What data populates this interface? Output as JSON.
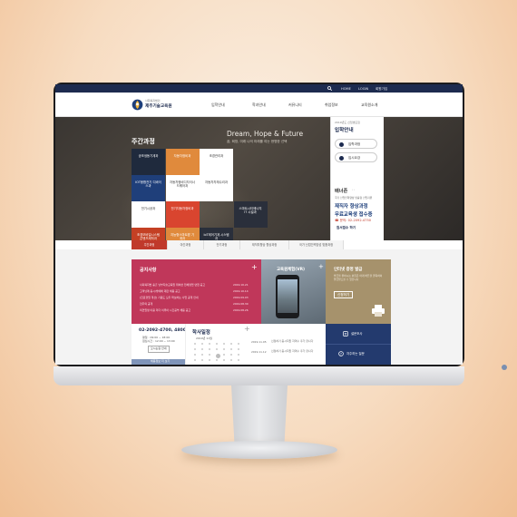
{
  "topbar": {
    "home": "HOME",
    "login": "LOGIN",
    "join": "회원가입"
  },
  "logo": {
    "sub": "사회복지법인",
    "name": "제주기술교육원"
  },
  "nav": [
    "입학안내",
    "학과안내",
    "커뮤니티",
    "취업정보",
    "교육원소개"
  ],
  "hero": {
    "title": "주간과정",
    "tag_en": "Dream, Hope & Future",
    "tag_ko": "꿈, 희망, 미래 나의 미래를 여는 현명한 선택"
  },
  "tiles": [
    {
      "label": "공조냉동기계과",
      "color": "#1f2a3d",
      "text": "#ffffff"
    },
    {
      "label": "자동차정비과",
      "color": "#e08a3c",
      "text": "#ffffff"
    },
    {
      "label": "조경관리과",
      "color": "#ffffff",
      "text": "#333333"
    },
    {
      "label": "",
      "color": "",
      "text": ""
    },
    {
      "label": "IOT융합전기 디바이스과",
      "color": "#1f3f7a",
      "text": "#ffffff"
    },
    {
      "label": "자동차정비디자이너 드웨어과",
      "color": "#ffffff",
      "text": "#333333"
    },
    {
      "label": "자동차차체수리과",
      "color": "#ffffff",
      "text": "#333333"
    },
    {
      "label": "",
      "color": "",
      "text": ""
    },
    {
      "label": "전기시공과",
      "color": "#ffffff",
      "text": "#333333"
    },
    {
      "label": "전기자동차정비과",
      "color": "#d9452f",
      "text": "#ffffff"
    },
    {
      "label": "",
      "color": "",
      "text": ""
    },
    {
      "label": "스마트시티에너지 IT 시설과",
      "color": "#2a2f3b",
      "text": "#ffffff"
    },
    {
      "label": "조경모바일시스템 콘텐츠제작과",
      "color": "#c44024",
      "text": "#ffffff"
    },
    {
      "label": "지능형스마트팜 기계과",
      "color": "#e08a3c",
      "text": "#ffffff"
    },
    {
      "label": "IoT제어기계 시스템과",
      "color": "#2a2f3b",
      "text": "#ffffff"
    }
  ],
  "side": {
    "small": "2019년도 신입생모집",
    "title": "입학안내",
    "btn1": "입학과정",
    "btn2": "입시요강",
    "banner_head": "배너존",
    "banner_sub": "국가 신업인력양성 맞춤형 신업지원",
    "banner_main": "재직자 향상과정",
    "banner_main2": "무료교육생 접수중",
    "banner_tel": "☎ 문의: 02-2092-4750",
    "banner_btn": "원서접수 하기"
  },
  "tabs": [
    "주간과정",
    "야간과정",
    "단기과정",
    "재직자향상 향상과정",
    "국가 신업인력양성 맞춤과정"
  ],
  "notice": {
    "title": "공지사항",
    "plus": "+",
    "items": [
      {
        "text": "사회복지법 충혼 남부지술교육원 위하면 전체영업 면접 공고",
        "date": "2019.10.21"
      },
      {
        "text": "고객님께 응시/밖에에 대한 채용 공고",
        "date": "2019.10.14"
      },
      {
        "text": "[진료협원 개선] 기용도 모두 확보하는 사업 공개 안내",
        "date": "2019.09.03"
      },
      {
        "text": "현주의 공개",
        "date": "2019.08.30"
      },
      {
        "text": "의견원생 이용 리더 이루어 시간공부 채용 공고",
        "date": "2019.08.26"
      }
    ]
  },
  "vr": {
    "title": "교육원체험(VR)",
    "plus": "+"
  },
  "cert": {
    "title": "인터넷 증명 발급",
    "desc": "발급을 원하시는 분들은 아래 버튼을 클릭하여 발급받으실 수 있습니다",
    "btn": "신청하기"
  },
  "contact": {
    "tel": "02-2092-4700, 4800",
    "hours1": "평일 : 09:00 ~ 18:00",
    "hours2": "점심시간 : 12:00 ~ 13:00",
    "btn": "오시는길 안내",
    "more": "채용정보 더 보기"
  },
  "schedule": {
    "title": "학사일정",
    "plus": "+",
    "month": "2019년 11월",
    "events": [
      {
        "date": "2019.11.05",
        "text": "신청하기 응시지원 자격수 추가 합니다"
      },
      {
        "date": "2019.11.12",
        "text": "신청하기 응시지원 자격수 추가 합니다"
      }
    ]
  },
  "quick": {
    "survey": "설문조사",
    "faq": "자주하는 질문"
  }
}
